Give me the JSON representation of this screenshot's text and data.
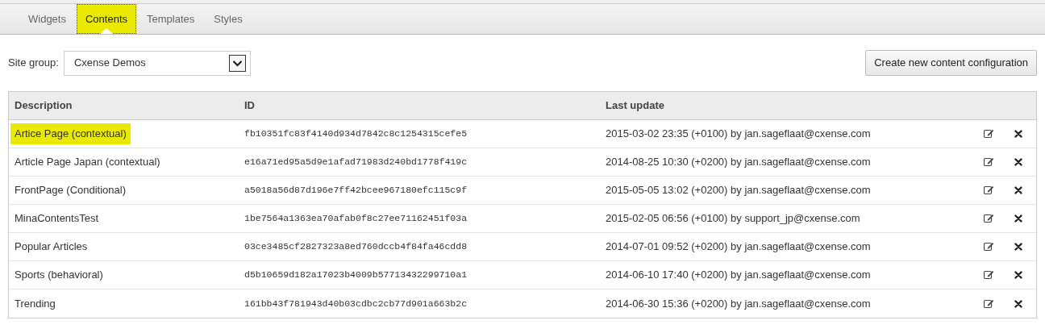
{
  "tabs": [
    {
      "label": "Widgets",
      "selected": false,
      "highlighted": false
    },
    {
      "label": "Contents",
      "selected": true,
      "highlighted": true
    },
    {
      "label": "Templates",
      "selected": false,
      "highlighted": false
    },
    {
      "label": "Styles",
      "selected": false,
      "highlighted": false
    }
  ],
  "site_group": {
    "label": "Site group:",
    "value": "Cxense Demos"
  },
  "create_button": "Create new content configuration",
  "table": {
    "columns": [
      "Description",
      "ID",
      "Last update"
    ],
    "rows": [
      {
        "description": "Artice Page (contextual)",
        "highlighted": true,
        "id": "fb10351fc83f4140d934d7842c8c1254315cefe5",
        "last_update": "2015-03-02 23:35 (+0100) by jan.sageflaat@cxense.com"
      },
      {
        "description": "Article Page Japan (contextual)",
        "highlighted": false,
        "id": "e16a71ed95a5d9e1afad71983d240bd1778f419c",
        "last_update": "2014-08-25 10:30 (+0200) by jan.sageflaat@cxense.com"
      },
      {
        "description": "FrontPage (Conditional)",
        "highlighted": false,
        "id": "a5018a56d87d196e7ff42bcee967180efc115c9f",
        "last_update": "2015-05-05 13:02 (+0200) by jan.sageflaat@cxense.com"
      },
      {
        "description": "MinaContentsTest",
        "highlighted": false,
        "id": "1be7564a1363ea70afab0f8c27ee71162451f03a",
        "last_update": "2015-02-05 06:56 (+0100) by support_jp@cxense.com"
      },
      {
        "description": "Popular Articles",
        "highlighted": false,
        "id": "03ce3485cf2827323a8ed760dccb4f84fa46cdd8",
        "last_update": "2014-07-01 09:52 (+0200) by jan.sageflaat@cxense.com"
      },
      {
        "description": "Sports (behavioral)",
        "highlighted": false,
        "id": "d5b10659d182a17023b4009b57713432299710a1",
        "last_update": "2014-06-10 17:40 (+0200) by jan.sageflaat@cxense.com"
      },
      {
        "description": "Trending",
        "highlighted": false,
        "id": "161bb43f781943d40b03cdbc2cb77d901a663b2c",
        "last_update": "2014-06-30 15:36 (+0200) by jan.sageflaat@cxense.com"
      }
    ]
  }
}
